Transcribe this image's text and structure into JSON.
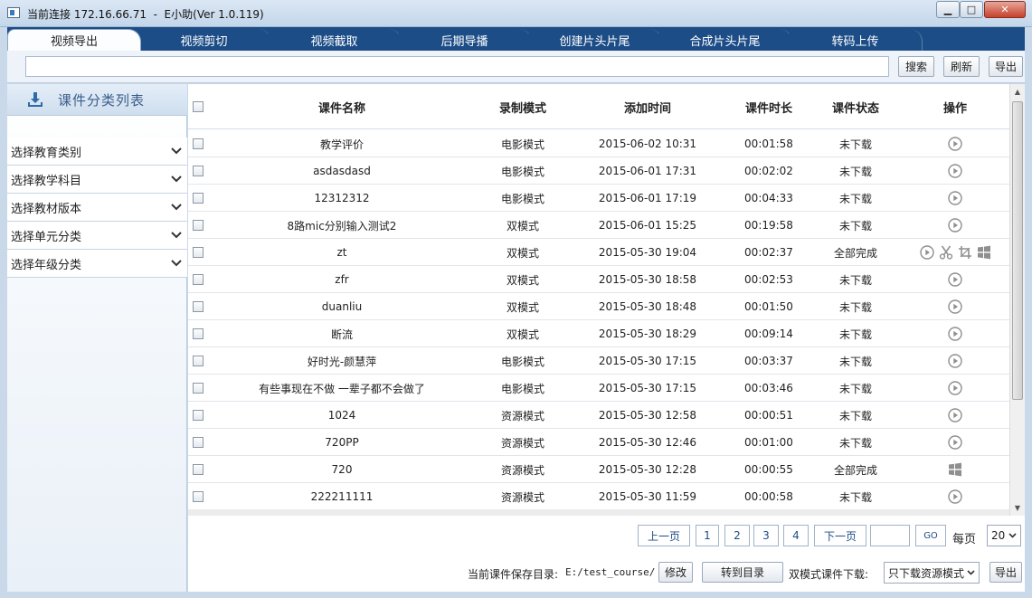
{
  "window": {
    "title": "当前连接 172.16.66.71  -  E小助(Ver 1.0.119)",
    "minimize_symbol": "▁",
    "maximize_symbol": "□",
    "close_symbol": "✕"
  },
  "tabs": [
    {
      "label": "视频导出",
      "active": true
    },
    {
      "label": "视频剪切",
      "active": false
    },
    {
      "label": "视频截取",
      "active": false
    },
    {
      "label": "后期导播",
      "active": false
    },
    {
      "label": "创建片头片尾",
      "active": false
    },
    {
      "label": "合成片头片尾",
      "active": false
    },
    {
      "label": "转码上传",
      "active": false
    }
  ],
  "toolbar": {
    "search_value": "",
    "search_label": "搜索",
    "refresh_label": "刷新",
    "export_label": "导出"
  },
  "sidebar": {
    "title": "课件分类列表",
    "items": [
      {
        "label": "选择教育类别"
      },
      {
        "label": "选择教学科目"
      },
      {
        "label": "选择教材版本"
      },
      {
        "label": "选择单元分类"
      },
      {
        "label": "选择年级分类"
      }
    ]
  },
  "table": {
    "columns": [
      "课件名称",
      "录制模式",
      "添加时间",
      "课件时长",
      "课件状态",
      "操作"
    ],
    "rows": [
      {
        "name": "教学评价",
        "mode": "电影模式",
        "time": "2015-06-02 10:31",
        "duration": "00:01:58",
        "status": "未下载",
        "ops": [
          "play-icon"
        ]
      },
      {
        "name": "asdasdasd",
        "mode": "电影模式",
        "time": "2015-06-01 17:31",
        "duration": "00:02:02",
        "status": "未下载",
        "ops": [
          "play-icon"
        ]
      },
      {
        "name": "12312312",
        "mode": "电影模式",
        "time": "2015-06-01 17:19",
        "duration": "00:04:33",
        "status": "未下载",
        "ops": [
          "play-icon"
        ]
      },
      {
        "name": "8路mic分别输入测试2",
        "mode": "双模式",
        "time": "2015-06-01 15:25",
        "duration": "00:19:58",
        "status": "未下载",
        "ops": [
          "play-icon"
        ]
      },
      {
        "name": "zt",
        "mode": "双模式",
        "time": "2015-05-30 19:04",
        "duration": "00:02:37",
        "status": "全部完成",
        "ops": [
          "play-icon",
          "scissors-icon",
          "crop-icon",
          "windows-icon"
        ]
      },
      {
        "name": "zfr",
        "mode": "双模式",
        "time": "2015-05-30 18:58",
        "duration": "00:02:53",
        "status": "未下载",
        "ops": [
          "play-icon"
        ]
      },
      {
        "name": "duanliu",
        "mode": "双模式",
        "time": "2015-05-30 18:48",
        "duration": "00:01:50",
        "status": "未下载",
        "ops": [
          "play-icon"
        ]
      },
      {
        "name": "断流",
        "mode": "双模式",
        "time": "2015-05-30 18:29",
        "duration": "00:09:14",
        "status": "未下载",
        "ops": [
          "play-icon"
        ]
      },
      {
        "name": "好时光-颜慧萍",
        "mode": "电影模式",
        "time": "2015-05-30 17:15",
        "duration": "00:03:37",
        "status": "未下载",
        "ops": [
          "play-icon"
        ]
      },
      {
        "name": "有些事现在不做 一辈子都不会做了",
        "mode": "电影模式",
        "time": "2015-05-30 17:15",
        "duration": "00:03:46",
        "status": "未下载",
        "ops": [
          "play-icon"
        ]
      },
      {
        "name": "1024",
        "mode": "资源模式",
        "time": "2015-05-30 12:58",
        "duration": "00:00:51",
        "status": "未下载",
        "ops": [
          "play-icon"
        ]
      },
      {
        "name": "720PP",
        "mode": "资源模式",
        "time": "2015-05-30 12:46",
        "duration": "00:01:00",
        "status": "未下载",
        "ops": [
          "play-icon"
        ]
      },
      {
        "name": "720",
        "mode": "资源模式",
        "time": "2015-05-30 12:28",
        "duration": "00:00:55",
        "status": "全部完成",
        "ops": [
          "windows-icon"
        ]
      },
      {
        "name": "222211111",
        "mode": "资源模式",
        "time": "2015-05-30 11:59",
        "duration": "00:00:58",
        "status": "未下载",
        "ops": [
          "play-icon"
        ]
      }
    ]
  },
  "pagination": {
    "prev_label": "上一页",
    "pages": [
      "1",
      "2",
      "3",
      "4"
    ],
    "next_label": "下一页",
    "go_label": "GO",
    "per_page_label": "每页",
    "per_page_value": "20"
  },
  "footer": {
    "save_dir_label": "当前课件保存目录:",
    "save_dir_value": "E:/test_course/",
    "modify_label": "修改",
    "goto_dir_label": "转到目录",
    "dual_mode_label": "双模式课件下载:",
    "dual_mode_value": "只下载资源模式",
    "export_label": "导出"
  },
  "colors": {
    "tab_bar": "#1d4d87",
    "active_tab": "#fbfdff",
    "sidebar_title": "#3a5e8a",
    "icon_gray": "#8f8f8f"
  }
}
